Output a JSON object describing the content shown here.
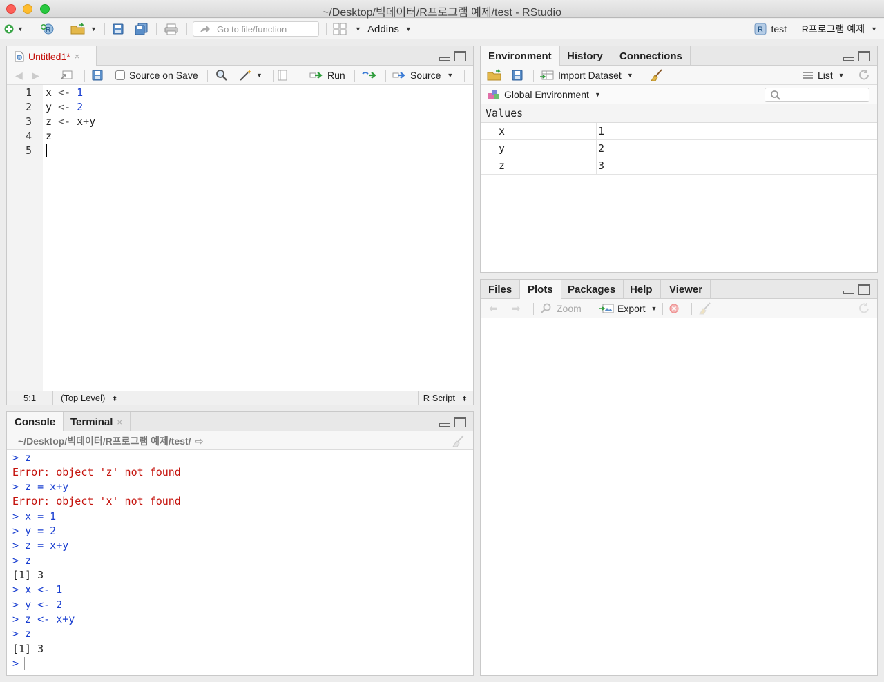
{
  "window": {
    "title": "~/Desktop/빅데이터/R프로그램 예제/test - RStudio"
  },
  "toolbar": {
    "goto_placeholder": "Go to file/function",
    "addins_label": "Addins",
    "project_label": "test — R프로그램 예제"
  },
  "editor": {
    "tab_label": "Untitled1*",
    "source_on_save_label": "Source on Save",
    "run_label": "Run",
    "source_label": "Source",
    "lines": [
      {
        "n": "1",
        "a": "x",
        "op": "<-",
        "b": "1"
      },
      {
        "n": "2",
        "a": "y",
        "op": "<-",
        "b": "2"
      },
      {
        "n": "3",
        "a": "z",
        "op": "<-",
        "b": "x+y"
      },
      {
        "n": "4",
        "a": "z",
        "op": "",
        "b": ""
      },
      {
        "n": "5",
        "a": "",
        "op": "",
        "b": ""
      }
    ],
    "status": {
      "position": "5:1",
      "scope": "(Top Level)",
      "filetype": "R Script"
    }
  },
  "console": {
    "tabs": [
      "Console",
      "Terminal"
    ],
    "path": "~/Desktop/빅데이터/R프로그램 예제/test/",
    "lines": [
      {
        "type": "in",
        "text": "z"
      },
      {
        "type": "err",
        "text": "Error: object 'z' not found"
      },
      {
        "type": "in",
        "text": "z = x+y"
      },
      {
        "type": "err",
        "text": "Error: object 'x' not found"
      },
      {
        "type": "in",
        "text": "x = 1"
      },
      {
        "type": "in",
        "text": "y = 2"
      },
      {
        "type": "in",
        "text": "z = x+y"
      },
      {
        "type": "in",
        "text": "z"
      },
      {
        "type": "out",
        "text": "[1] 3"
      },
      {
        "type": "in",
        "text": "x <- 1"
      },
      {
        "type": "in",
        "text": "y <- 2"
      },
      {
        "type": "in",
        "text": "z <- x+y"
      },
      {
        "type": "in",
        "text": "z"
      },
      {
        "type": "out",
        "text": "[1] 3"
      }
    ],
    "prompt": ">"
  },
  "environment": {
    "tabs": [
      "Environment",
      "History",
      "Connections"
    ],
    "import_label": "Import Dataset",
    "list_label": "List",
    "scope_label": "Global Environment",
    "section_label": "Values",
    "values": [
      {
        "name": "x",
        "value": "1"
      },
      {
        "name": "y",
        "value": "2"
      },
      {
        "name": "z",
        "value": "3"
      }
    ]
  },
  "files": {
    "tabs": [
      "Files",
      "Plots",
      "Packages",
      "Help",
      "Viewer"
    ],
    "zoom_label": "Zoom",
    "export_label": "Export"
  },
  "colors": {
    "accent_blue": "#1a3fd1",
    "error_red": "#c4110b",
    "run_green": "#2e9c3b"
  }
}
